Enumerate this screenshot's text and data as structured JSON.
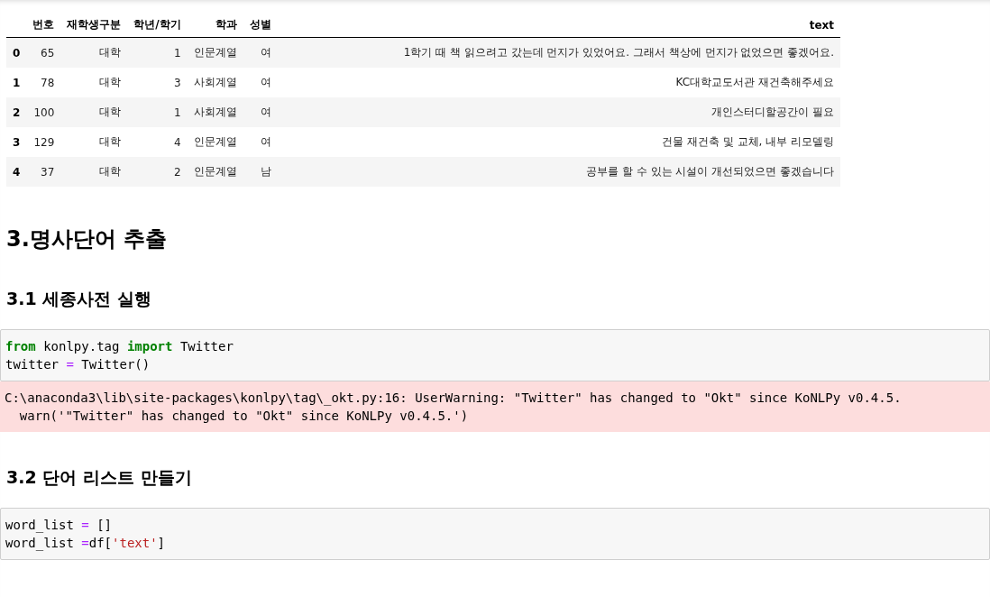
{
  "table": {
    "columns": [
      "번호",
      "재학생구분",
      "학년/학기",
      "학과",
      "성별",
      "text"
    ],
    "rows": [
      {
        "index": "0",
        "cells": [
          "65",
          "대학",
          "1",
          "인문계열",
          "여",
          "1학기 때 책 읽으려고 갔는데 먼지가 있었어요. 그래서 책상에 먼지가 없었으면 좋겠어요."
        ]
      },
      {
        "index": "1",
        "cells": [
          "78",
          "대학",
          "3",
          "사회계열",
          "여",
          "KC대학교도서관 재건축해주세요"
        ]
      },
      {
        "index": "2",
        "cells": [
          "100",
          "대학",
          "1",
          "사회계열",
          "여",
          "개인스터디할공간이 필요"
        ]
      },
      {
        "index": "3",
        "cells": [
          "129",
          "대학",
          "4",
          "인문계열",
          "여",
          "건물 재건축 및 교체, 내부 리모델링"
        ]
      },
      {
        "index": "4",
        "cells": [
          "37",
          "대학",
          "2",
          "인문계열",
          "남",
          "공부를 할 수 있는 시설이 개선되었으면 좋겠습니다"
        ]
      }
    ]
  },
  "sections": [
    {
      "kind": "h2",
      "text": "3.명사단어 추출"
    },
    {
      "kind": "h3",
      "text": "3.1 세종사전 실행"
    },
    {
      "kind": "code",
      "lines": [
        [
          {
            "kind": "keyword",
            "text": "from"
          },
          {
            "kind": "plain",
            "text": " konlpy.tag "
          },
          {
            "kind": "keyword",
            "text": "import"
          },
          {
            "kind": "plain",
            "text": " Twitter"
          }
        ],
        [
          {
            "kind": "plain",
            "text": "twitter "
          },
          {
            "kind": "op",
            "text": "="
          },
          {
            "kind": "plain",
            "text": " Twitter()"
          }
        ]
      ]
    },
    {
      "kind": "stderr",
      "lines": [
        "C:\\anaconda3\\lib\\site-packages\\konlpy\\tag\\_okt.py:16: UserWarning: \"Twitter\" has changed to \"Okt\" since KoNLPy v0.4.5.",
        "  warn('\"Twitter\" has changed to \"Okt\" since KoNLPy v0.4.5.')"
      ]
    },
    {
      "kind": "h3",
      "text": "3.2 단어 리스트 만들기"
    },
    {
      "kind": "code",
      "lines": [
        [
          {
            "kind": "plain",
            "text": "word_list "
          },
          {
            "kind": "op",
            "text": "="
          },
          {
            "kind": "plain",
            "text": " []"
          }
        ],
        [
          {
            "kind": "plain",
            "text": "word_list "
          },
          {
            "kind": "op",
            "text": "="
          },
          {
            "kind": "plain",
            "text": "df["
          },
          {
            "kind": "string",
            "text": "'text'"
          },
          {
            "kind": "plain",
            "text": "]"
          }
        ]
      ]
    }
  ]
}
